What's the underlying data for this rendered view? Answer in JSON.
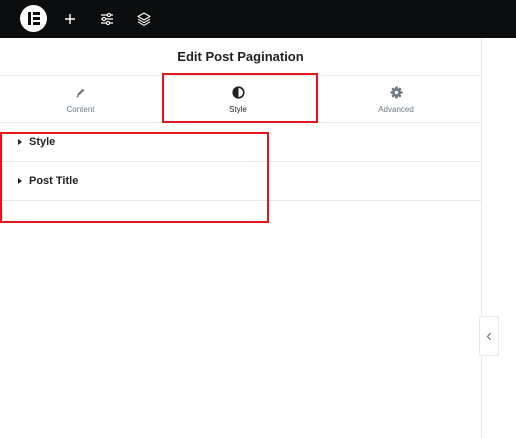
{
  "topbar": {
    "icons": [
      "elementor-logo-icon",
      "plus-icon",
      "sliders-icon",
      "layers-icon"
    ]
  },
  "panel": {
    "title": "Edit Post Pagination",
    "tabs": [
      {
        "label": "Content",
        "icon": "pencil-icon",
        "active": false
      },
      {
        "label": "Style",
        "icon": "half-circle-icon",
        "active": true
      },
      {
        "label": "Advanced",
        "icon": "gear-icon",
        "active": false
      }
    ],
    "sections": [
      {
        "label": "Style"
      },
      {
        "label": "Post Title"
      }
    ]
  },
  "colors": {
    "topbar": "#0c0d0e",
    "highlight": "#e4161b",
    "text": "#1f2124",
    "muted": "#6d7882",
    "divider": "#e6e8ea"
  }
}
